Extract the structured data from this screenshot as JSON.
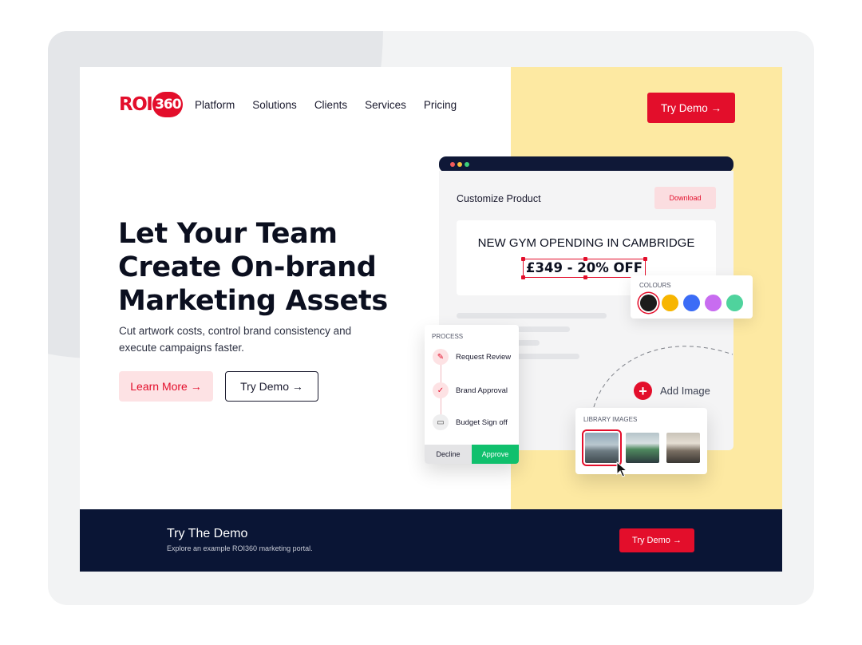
{
  "logo": {
    "roi": "ROI",
    "num": "360"
  },
  "nav": {
    "items": [
      "Platform",
      "Solutions",
      "Clients",
      "Services",
      "Pricing"
    ]
  },
  "header": {
    "cta": "Try Demo →"
  },
  "hero": {
    "title": "Let Your Team Create On-brand Marketing Assets",
    "subtitle": "Cut artwork costs, control brand consistency and execute campaigns faster.",
    "learn_more": "Learn More →",
    "try_demo": "Try Demo  →"
  },
  "mockup": {
    "title": "Customize Product",
    "download": "Download",
    "headline": "NEW GYM OPENDING IN CAMBRIDGE",
    "price": "£349 - 20% OFF",
    "colours_label": "COLOURS",
    "colours": [
      "#1c1c1c",
      "#f7b500",
      "#3b6cf6",
      "#c86cf0",
      "#4fd39d"
    ],
    "process_label": "PROCESS",
    "process_steps": [
      "Request Review",
      "Brand Approval",
      "Budget Sign off"
    ],
    "decline": "Decline",
    "approve": "Approve",
    "add_image": "Add Image",
    "library_label": "LIBRARY IMAGES"
  },
  "footer": {
    "title": "Try The Demo",
    "subtitle": "Explore an example ROI360 marketing portal.",
    "cta": "Try Demo  →"
  },
  "colors": {
    "brand_red": "#e30e2b",
    "navy": "#0a1535",
    "yellow": "#fde9a2",
    "approve_green": "#10c06d"
  }
}
